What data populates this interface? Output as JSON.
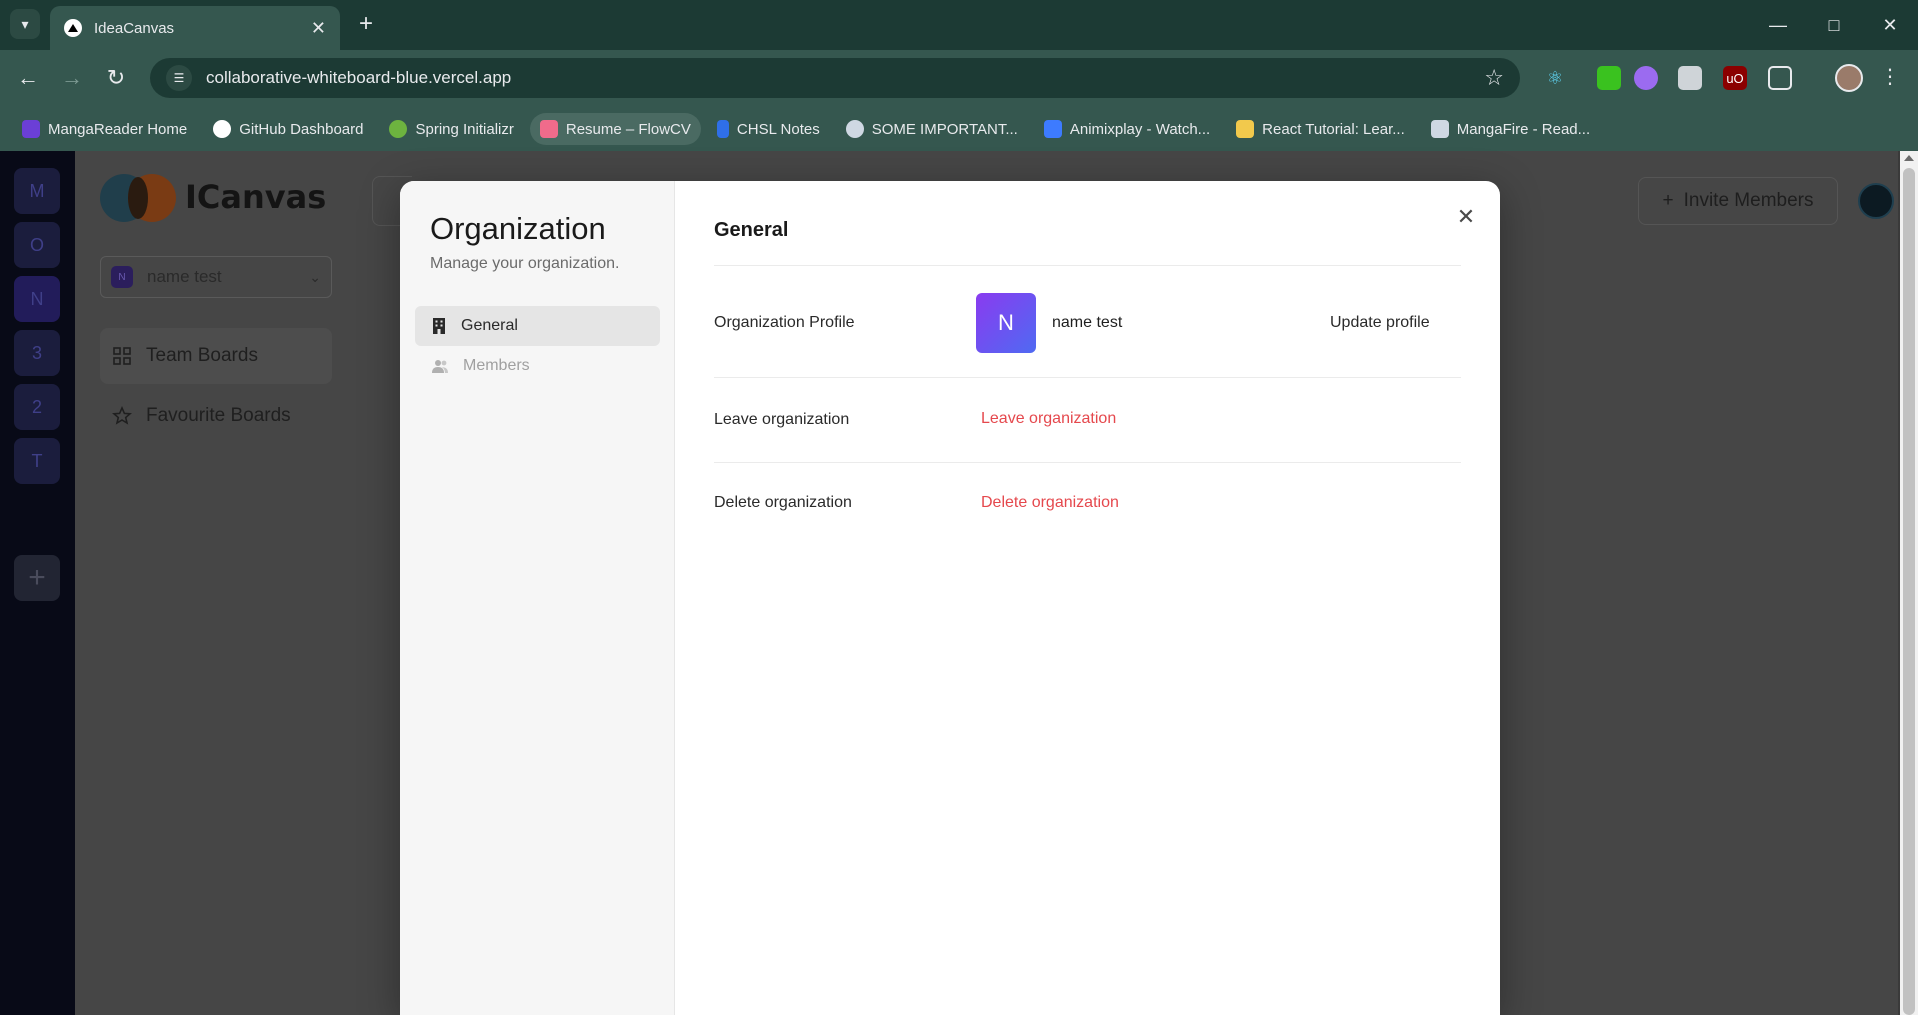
{
  "browser": {
    "tab_title": "IdeaCanvas",
    "url": "collaborative-whiteboard-blue.vercel.app",
    "bookmarks": [
      {
        "label": "MangaReader Home",
        "color": "#6b3fd6"
      },
      {
        "label": "GitHub Dashboard",
        "color": "#ffffff"
      },
      {
        "label": "Spring Initializr",
        "color": "#6db33f"
      },
      {
        "label": "Resume – FlowCV",
        "color": "#f06b8b"
      },
      {
        "label": "CHSL Notes",
        "color": "#2f6fe8"
      },
      {
        "label": "SOME IMPORTANT...",
        "color": "#cfd8e3"
      },
      {
        "label": "Animixplay - Watch...",
        "color": "#3d7bff"
      },
      {
        "label": "React Tutorial: Lear...",
        "color": "#f2c94c"
      },
      {
        "label": "MangaFire - Read...",
        "color": "#cfd8e3"
      }
    ]
  },
  "app": {
    "org_rail": [
      "M",
      "O",
      "N",
      "3",
      "2",
      "T"
    ],
    "logo_text": "ICanvas",
    "org_switcher": {
      "name": "name test",
      "initial": "N"
    },
    "sidebar_links": [
      "Team Boards",
      "Favourite Boards"
    ],
    "invite_label": "Invite Members"
  },
  "modal": {
    "title": "Organization",
    "subtitle": "Manage your organization.",
    "nav": [
      "General",
      "Members"
    ],
    "section_title": "General",
    "profile_label": "Organization Profile",
    "org_initial": "N",
    "org_name": "name test",
    "update_profile": "Update profile",
    "leave_label": "Leave organization",
    "leave_action": "Leave organization",
    "delete_label": "Delete organization",
    "delete_action": "Delete organization"
  }
}
